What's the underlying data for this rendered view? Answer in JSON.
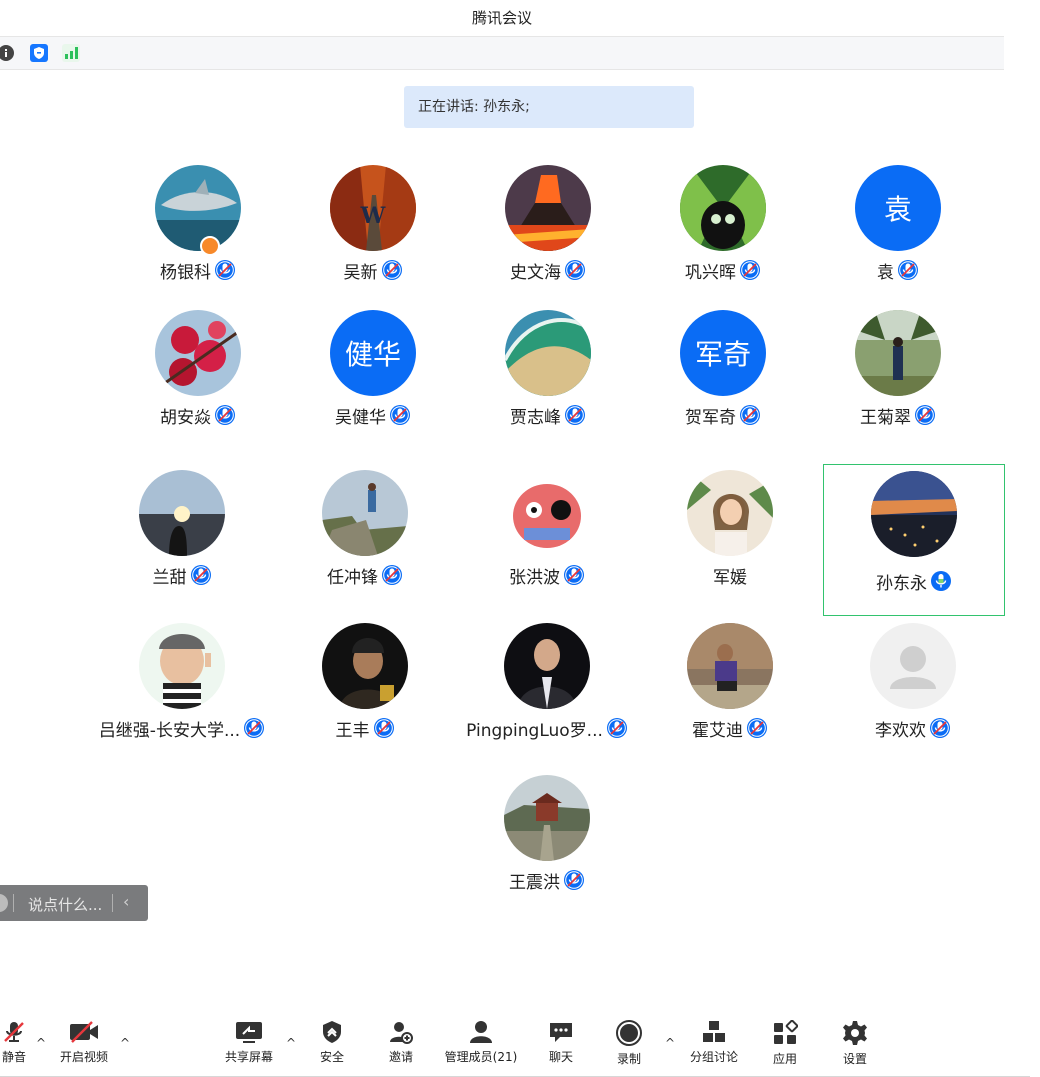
{
  "window": {
    "title": "腾讯会议"
  },
  "speaking": {
    "label": "正在讲话: 孙东永;"
  },
  "participants": [
    {
      "name": "杨银科",
      "avatar": "photo-shark",
      "host": true,
      "mic": "muted"
    },
    {
      "name": "吴新",
      "avatar": "photo-autumn-road",
      "mic": "muted"
    },
    {
      "name": "史文海",
      "avatar": "photo-volcano",
      "mic": "muted"
    },
    {
      "name": "巩兴晖",
      "avatar": "photo-cartoon-alien",
      "mic": "muted"
    },
    {
      "name": "袁",
      "avatar_text": "袁",
      "mic": "muted"
    },
    {
      "name": "胡安焱",
      "avatar": "photo-red-blossoms",
      "mic": "muted"
    },
    {
      "name": "吴健华",
      "avatar_text": "健华",
      "mic": "muted"
    },
    {
      "name": "贾志峰",
      "avatar": "photo-wave",
      "mic": "muted"
    },
    {
      "name": "贺军奇",
      "avatar_text": "军奇",
      "mic": "muted"
    },
    {
      "name": "王菊翠",
      "avatar": "photo-garden-person",
      "mic": "muted"
    },
    {
      "name": "兰甜",
      "avatar": "photo-sunset-lake",
      "mic": "muted"
    },
    {
      "name": "任冲锋",
      "avatar": "photo-cliff-hiker",
      "mic": "muted"
    },
    {
      "name": "张洪波",
      "avatar": "photo-cartoon-pirate",
      "mic": "muted"
    },
    {
      "name": "军媛",
      "avatar": "photo-woman-plants",
      "mic": "none"
    },
    {
      "name": "孙东永",
      "avatar": "photo-city-dusk",
      "mic": "speaking",
      "active": true
    },
    {
      "name": "吕继强-长安大学...",
      "avatar": "photo-cartoon-man",
      "mic": "muted"
    },
    {
      "name": "王丰",
      "avatar": "photo-man-dark",
      "mic": "muted"
    },
    {
      "name": "PingpingLuo罗...",
      "avatar": "photo-man-suit",
      "mic": "muted"
    },
    {
      "name": "霍艾迪",
      "avatar": "photo-man-sitting",
      "mic": "muted"
    },
    {
      "name": "李欢欢",
      "avatar": "default-person",
      "mic": "muted"
    },
    {
      "name": "王震洪",
      "avatar": "photo-temple",
      "mic": "muted"
    }
  ],
  "chat": {
    "placeholder": "说点什么..."
  },
  "toolbar": {
    "mute": "静音",
    "video": "开启视频",
    "share": "共享屏幕",
    "security": "安全",
    "invite": "邀请",
    "members": "管理成员(21)",
    "chat": "聊天",
    "record": "录制",
    "breakout": "分组讨论",
    "apps": "应用",
    "settings": "设置"
  },
  "colors": {
    "accent": "#0a6cf5",
    "speaking_bg": "#dce9fb",
    "active_border": "#32c36e",
    "muted_red": "#e6373c"
  }
}
